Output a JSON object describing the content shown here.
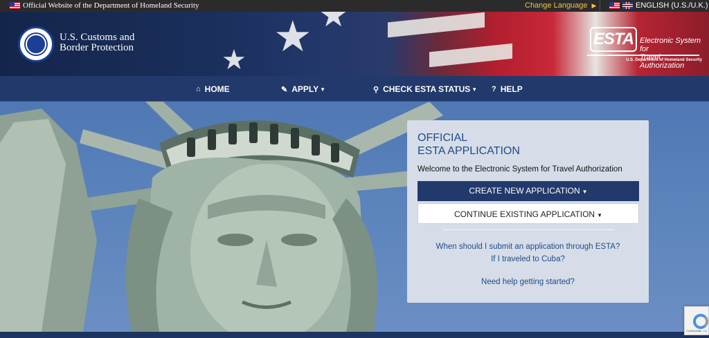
{
  "topbar": {
    "official_text": "Official Website of the Department of Homeland Security",
    "change_language": "Change Language",
    "current_language": "ENGLISH (U.S./U.K.)"
  },
  "header": {
    "agency_line1": "U.S. Customs and",
    "agency_line2": "Border Protection",
    "esta_logo_text": "ESTA",
    "esta_full_line1": "Electronic System for",
    "esta_full_line2": "Travel Authorization",
    "esta_dhs": "U.S. Department of Homeland Security"
  },
  "nav": {
    "items": [
      {
        "label": "HOME",
        "icon": "home-icon",
        "dropdown": false
      },
      {
        "label": "APPLY",
        "icon": "pencil-icon",
        "dropdown": true
      },
      {
        "label": "CHECK ESTA STATUS",
        "icon": "search-icon",
        "dropdown": true
      },
      {
        "label": "HELP",
        "icon": "question-circle-icon",
        "dropdown": false
      }
    ]
  },
  "panel": {
    "title_line1": "OFFICIAL",
    "title_line2": "ESTA APPLICATION",
    "welcome": "Welcome to the Electronic System for Travel Authorization",
    "create_button": "CREATE NEW APPLICATION",
    "continue_button": "CONTINUE EXISTING APPLICATION",
    "link_when": "When should I submit an application through ESTA?",
    "link_cuba": "If I traveled to Cuba?",
    "link_help": "Need help getting started?"
  },
  "recaptcha": {
    "text": "Confidentialité - Co"
  },
  "colors": {
    "navy": "#22396b",
    "link_blue": "#1f4b88",
    "panel_bg": "#d6dde8",
    "language_gold": "#f3c344"
  }
}
